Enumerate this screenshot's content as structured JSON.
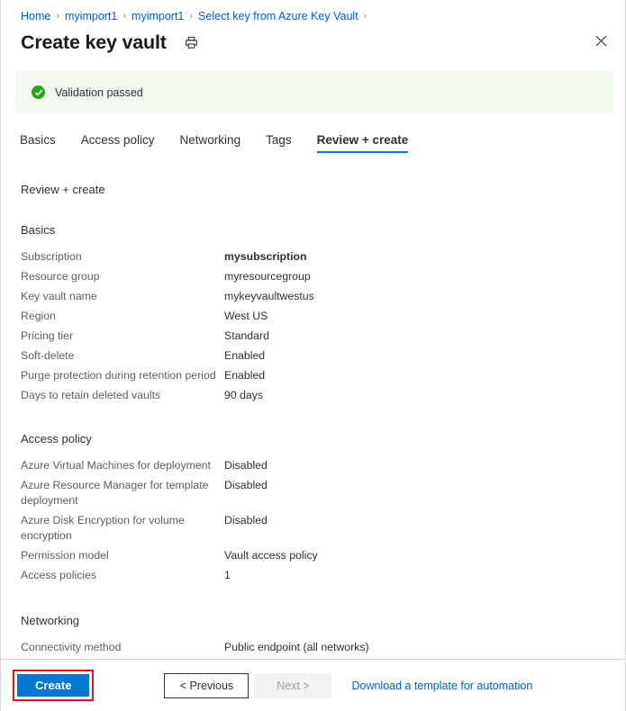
{
  "breadcrumb": {
    "items": [
      {
        "label": "Home"
      },
      {
        "label": "myimport1"
      },
      {
        "label": "myimport1"
      },
      {
        "label": "Select key from Azure Key Vault"
      }
    ],
    "separator": "›"
  },
  "header": {
    "title": "Create key vault",
    "print_icon": "printer-icon",
    "close_icon": "close-icon"
  },
  "banner": {
    "icon": "success-check-icon",
    "text": "Validation passed",
    "background_color": "#f3faf0",
    "icon_color": "#2aa318"
  },
  "tabs": [
    {
      "label": "Basics",
      "active": false
    },
    {
      "label": "Access policy",
      "active": false
    },
    {
      "label": "Networking",
      "active": false
    },
    {
      "label": "Tags",
      "active": false
    },
    {
      "label": "Review + create",
      "active": true
    }
  ],
  "tab_accent_color": "#0078d4",
  "main": {
    "review_heading": "Review + create",
    "sections": [
      {
        "title": "Basics",
        "rows": [
          {
            "label": "Subscription",
            "value": "mysubscription",
            "bold": true
          },
          {
            "label": "Resource group",
            "value": "myresourcegroup",
            "bold": false
          },
          {
            "label": "Key vault name",
            "value": "mykeyvaultwestus",
            "bold": false
          },
          {
            "label": "Region",
            "value": "West US",
            "bold": false
          },
          {
            "label": "Pricing tier",
            "value": "Standard",
            "bold": false
          },
          {
            "label": "Soft-delete",
            "value": "Enabled",
            "bold": false
          },
          {
            "label": "Purge protection during retention period",
            "value": "Enabled",
            "bold": false
          },
          {
            "label": "Days to retain deleted vaults",
            "value": "90 days",
            "bold": false
          }
        ]
      },
      {
        "title": "Access policy",
        "rows": [
          {
            "label": "Azure Virtual Machines for deployment",
            "value": "Disabled",
            "bold": false
          },
          {
            "label": "Azure Resource Manager for template deployment",
            "value": "Disabled",
            "bold": false
          },
          {
            "label": "Azure Disk Encryption for volume encryption",
            "value": "Disabled",
            "bold": false
          },
          {
            "label": "Permission model",
            "value": "Vault access policy",
            "bold": false
          },
          {
            "label": "Access policies",
            "value": "1",
            "bold": false
          }
        ]
      },
      {
        "title": "Networking",
        "rows": [
          {
            "label": "Connectivity method",
            "value": "Public endpoint (all networks)",
            "bold": false
          }
        ]
      }
    ]
  },
  "footer": {
    "create_label": "Create",
    "create_color": "#0078d4",
    "create_highlight_color": "#e81123",
    "previous_label": "< Previous",
    "next_label": "Next >",
    "next_disabled": true,
    "download_label": "Download a template for automation",
    "link_color": "#015cda"
  }
}
